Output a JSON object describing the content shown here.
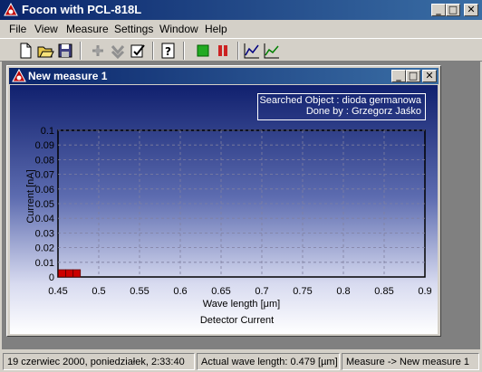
{
  "app": {
    "title": "Focon with PCL-818L"
  },
  "menu": [
    "File",
    "View",
    "Measure",
    "Settings",
    "Window",
    "Help"
  ],
  "toolbar": {
    "buttons": [
      {
        "name": "new-icon"
      },
      {
        "name": "open-icon"
      },
      {
        "name": "save-icon"
      },
      {
        "name": "connect-icon"
      },
      {
        "name": "download-icon"
      },
      {
        "name": "properties-icon"
      },
      {
        "name": "help-icon"
      },
      {
        "name": "start-icon"
      },
      {
        "name": "pause-icon"
      },
      {
        "name": "chart-icon"
      },
      {
        "name": "chart-alt-icon"
      }
    ]
  },
  "child_window": {
    "title": "New measure 1"
  },
  "info": {
    "searched_object": "Searched Object : dioda germanowa",
    "done_by": "Done by : Grzegorz Jaśko"
  },
  "chart_data": {
    "type": "scatter",
    "title": "Detector Current",
    "xlabel": "Wave length [μm]",
    "ylabel": "Current [nA]",
    "xlim": [
      0.45,
      0.9
    ],
    "ylim": [
      0,
      0.1
    ],
    "x_ticks": [
      "0.45",
      "0.5",
      "0.55",
      "0.6",
      "0.65",
      "0.7",
      "0.75",
      "0.8",
      "0.85",
      "0.9"
    ],
    "y_ticks": [
      "0",
      "0.01",
      "0.02",
      "0.03",
      "0.04",
      "0.05",
      "0.06",
      "0.07",
      "0.08",
      "0.09",
      "0.1"
    ],
    "grid": true,
    "series": [
      {
        "x": [
          0.455,
          0.464,
          0.473
        ],
        "y": [
          0,
          0,
          0
        ],
        "color": "#cc0000"
      }
    ]
  },
  "status": {
    "datetime": "19 czerwiec 2000, poniedziałek, 2:33:40",
    "wavelength": "Actual wave length: 0.479 [µm]",
    "measure": "Measure -> New measure 1"
  },
  "window_controls": {
    "minimize": "_",
    "maximize": "□",
    "close": "✕"
  }
}
